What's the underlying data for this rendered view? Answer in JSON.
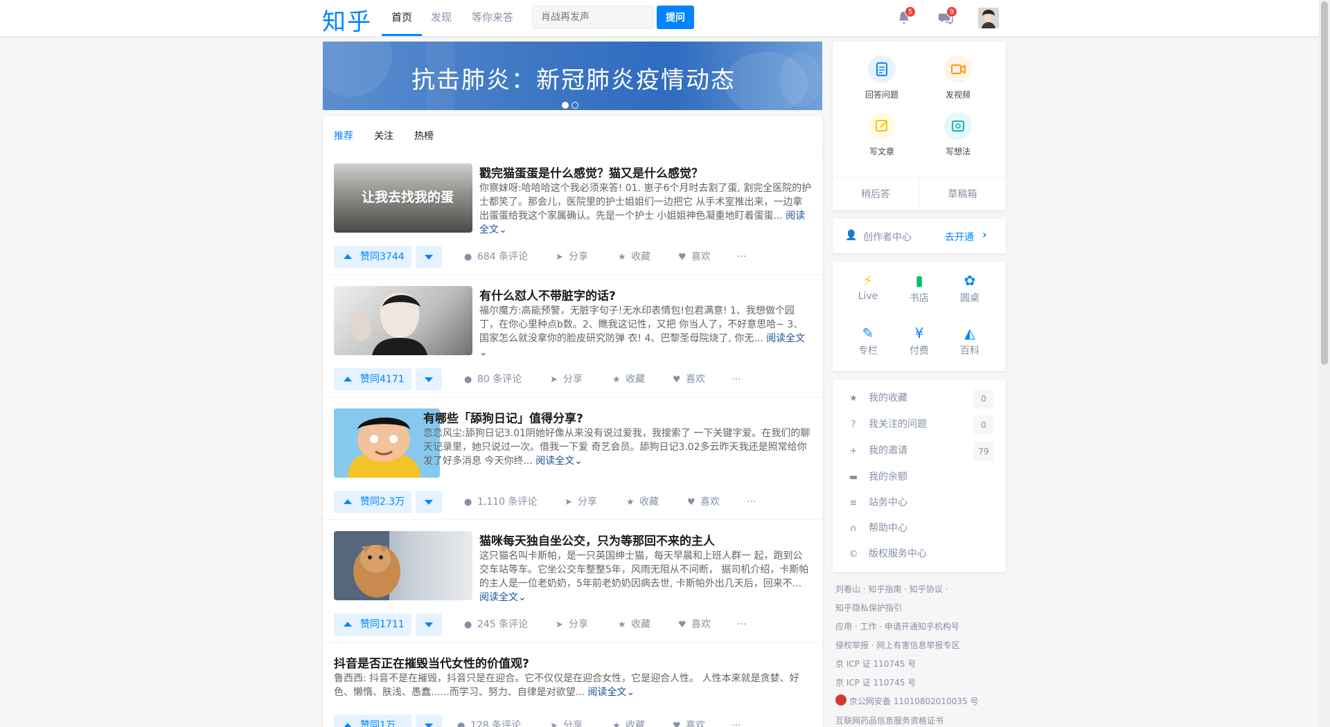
{
  "header": {
    "logo": "知乎",
    "tabs": [
      {
        "label": "首页",
        "active": true
      },
      {
        "label": "发现",
        "active": false
      },
      {
        "label": "等你来答",
        "active": false
      }
    ],
    "search_placeholder": "肖战再发声",
    "ask_label": "提问",
    "notifications_count": "5",
    "messages_count": "9"
  },
  "banner": {
    "title": "抗击肺炎：新冠肺炎疫情动态",
    "slide_count": 2,
    "active_slide": 1
  },
  "feed": {
    "tabs": [
      {
        "label": "推荐",
        "active": true
      },
      {
        "label": "关注",
        "active": false
      },
      {
        "label": "热榜",
        "active": false
      }
    ],
    "items": [
      {
        "title": "戳完猫蛋蛋是什么感觉？猫又是什么感觉？",
        "thumb_caption": "让我去找我的蛋",
        "excerpt": "你察妹呀:哈哈哈这个我必须来答! 01. 崽子6个月时去割了蛋, 割完全医院的护士都笑了。那会儿，医院里的护士姐姐们一边把它 从手术室推出来，一边拿出蛋蛋给我这个家属确认。先是一个护士 小姐姐神色凝重地盯着蛋蛋...",
        "read_more": "阅读全文",
        "vote_label": "赞同3744",
        "comments": "684 条评论",
        "share": "分享",
        "collect": "收藏",
        "like": "喜欢"
      },
      {
        "title": "有什么怼人不带脏字的话?",
        "excerpt": "福尔魔方:高能预警，无脏字句子!无水印表情包!包君满意! 1、我想做个园丁，在你心里种点b数。2、瞧我这记性，又把 你当人了，不好意思哈~ 3、国家怎么就没拿你的脸皮研究防弹 衣! 4、巴黎圣母院烧了, 你无...",
        "read_more": "阅读全文",
        "vote_label": "赞同4171",
        "comments": "80 条评论",
        "share": "分享",
        "collect": "收藏",
        "like": "喜欢"
      },
      {
        "title": "有哪些「舔狗日记」值得分享?",
        "excerpt": "恋恋风尘:舔狗日记3.01阴她好像从来没有说过爱我，我搜索了 一下关键字爱。在我们的聊天记录里，她只说过一次。借我一下爱 奇艺会员。舔狗日记3.02多云昨天我还是照常给你发了好多消息 今天你终...",
        "read_more": "阅读全文",
        "vote_label": "赞同2.3万",
        "comments": "1,110 条评论",
        "share": "分享",
        "collect": "收藏",
        "like": "喜欢"
      },
      {
        "title": "猫咪每天独自坐公交，只为等那回不来的主人",
        "excerpt": "这只猫名叫卡斯帕，是一只英国绅士猫，每天早晨和上班人群一 起，跑到公交车站等车。它坐公交车整整5年，风雨无阻从不间断， 据司机介绍，卡斯帕的主人是一位老奶奶，5年前老奶奶因病去世, 卡斯帕外出几天后，回来不...",
        "read_more": "阅读全文",
        "vote_label": "赞同1711",
        "comments": "245 条评论",
        "share": "分享",
        "collect": "收藏",
        "like": "喜欢"
      },
      {
        "title": "抖音是否正在摧毁当代女性的价值观?",
        "excerpt": "鲁西西: 抖音不是在摧毁，抖音只是在迎合。它不仅仅是在迎合女性，它是迎合人性。 人性本来就是贪婪、好色、懒惰、肤浅、愚蠢......而学习、努力、自律是对欲望...",
        "read_more": "阅读全文",
        "vote_label": "赞同1万",
        "comments": "128 条评论",
        "share": "分享",
        "collect": "收藏",
        "like": "喜欢"
      }
    ]
  },
  "sidebar": {
    "create": {
      "items": [
        {
          "label": "回答问题",
          "icon": "answer-icon",
          "color": "#0084ff",
          "bg": "#e5f2ff"
        },
        {
          "label": "发视频",
          "icon": "video-icon",
          "color": "#ff9607",
          "bg": "#fff4e6"
        },
        {
          "label": "写文章",
          "icon": "write-article-icon",
          "color": "#f7c300",
          "bg": "#fffbe6"
        },
        {
          "label": "写想法",
          "icon": "idea-icon",
          "color": "#0bb8b8",
          "bg": "#e6f8f8"
        }
      ],
      "later": "稍后答",
      "drafts": "草稿箱"
    },
    "creator": {
      "label": "创作者中心",
      "action": "去开通"
    },
    "grid": [
      {
        "label": "Live",
        "icon": "lightning-icon",
        "color": "#ffcf00",
        "glyph": "⚡"
      },
      {
        "label": "书店",
        "icon": "book-icon",
        "color": "#00c16a",
        "glyph": "▮"
      },
      {
        "label": "圆桌",
        "icon": "roundtable-icon",
        "color": "#0084ff",
        "glyph": "✿"
      },
      {
        "label": "专栏",
        "icon": "pen-icon",
        "color": "#0084ff",
        "glyph": "✎"
      },
      {
        "label": "付费",
        "icon": "yen-icon",
        "color": "#0084ff",
        "glyph": "¥"
      },
      {
        "label": "百科",
        "icon": "wiki-icon",
        "color": "#0084ff",
        "glyph": "◭"
      }
    ],
    "list": [
      {
        "label": "我的收藏",
        "icon": "star-icon",
        "glyph": "★",
        "count": "0"
      },
      {
        "label": "我关注的问题",
        "icon": "question-icon",
        "glyph": "?",
        "count": "0"
      },
      {
        "label": "我的邀请",
        "icon": "invite-icon",
        "glyph": "+",
        "count": "79"
      },
      {
        "label": "我的余额",
        "icon": "wallet-icon",
        "glyph": "▬",
        "count": ""
      },
      {
        "label": "站务中心",
        "icon": "flag-icon",
        "glyph": "≡",
        "count": ""
      },
      {
        "label": "帮助中心",
        "icon": "headset-icon",
        "glyph": "∩",
        "count": ""
      },
      {
        "label": "版权服务中心",
        "icon": "copyright-icon",
        "glyph": "©",
        "count": ""
      }
    ]
  },
  "footer": {
    "lines": [
      "刘看山 · 知乎指南 · 知乎协议 ·",
      "知乎隐私保护指引",
      "应用 · 工作 · 申请开通知乎机构号",
      "侵权举报 · 网上有害信息举报专区",
      "京 ICP 证 110745 号",
      "京 ICP 证 110745 号",
      "京公网安备 11010802010035 号",
      "互联网药品信息服务资格证书"
    ]
  },
  "colors": {
    "brand": "#0084ff",
    "badge": "#f1403c"
  }
}
